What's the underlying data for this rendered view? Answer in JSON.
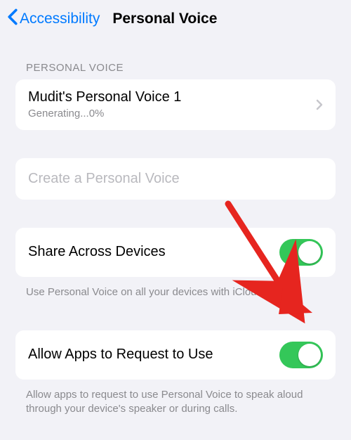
{
  "nav": {
    "back_label": "Accessibility",
    "title": "Personal Voice"
  },
  "section1": {
    "header": "PERSONAL VOICE",
    "voice_name": "Mudit's Personal Voice 1",
    "voice_status": "Generating...0%"
  },
  "create": {
    "label": "Create a Personal Voice"
  },
  "share": {
    "label": "Share Across Devices",
    "enabled": true,
    "footer": "Use Personal Voice on all your devices with iCloud."
  },
  "allow": {
    "label": "Allow Apps to Request to Use",
    "enabled": true,
    "footer": "Allow apps to request to use Personal Voice to speak aloud through your device's speaker or during calls."
  },
  "colors": {
    "accent": "#007aff",
    "toggle_on": "#34c759",
    "arrow": "#e6251f"
  }
}
